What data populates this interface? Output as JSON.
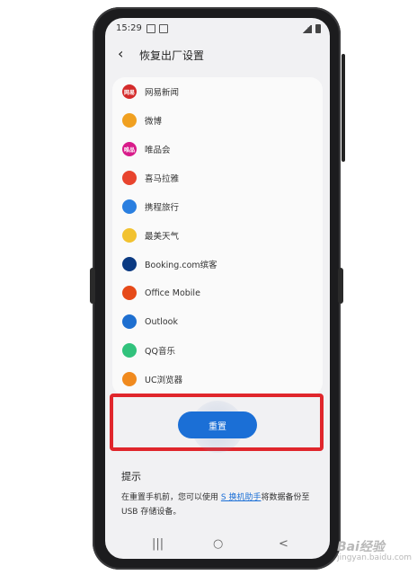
{
  "status": {
    "time": "15:29"
  },
  "header": {
    "title": "恢复出厂设置"
  },
  "apps": [
    {
      "name": "网易新闻",
      "color": "#d42b2b",
      "icon": "netease-news-icon",
      "glyph": "网易"
    },
    {
      "name": "微博",
      "color": "#f0a020",
      "icon": "weibo-icon",
      "glyph": ""
    },
    {
      "name": "唯品会",
      "color": "#d81b8a",
      "icon": "vipshop-icon",
      "glyph": "唯品"
    },
    {
      "name": "喜马拉雅",
      "color": "#e8442e",
      "icon": "ximalaya-icon",
      "glyph": ""
    },
    {
      "name": "携程旅行",
      "color": "#2a7fe0",
      "icon": "ctrip-icon",
      "glyph": ""
    },
    {
      "name": "最美天气",
      "color": "#f2c230",
      "icon": "weather-icon",
      "glyph": ""
    },
    {
      "name": "Booking.com缤客",
      "color": "#0b3a82",
      "icon": "booking-icon",
      "glyph": ""
    },
    {
      "name": "Office Mobile",
      "color": "#e64a19",
      "icon": "office-icon",
      "glyph": ""
    },
    {
      "name": "Outlook",
      "color": "#1e6fd0",
      "icon": "outlook-icon",
      "glyph": ""
    },
    {
      "name": "QQ音乐",
      "color": "#31c27c",
      "icon": "qq-music-icon",
      "glyph": ""
    },
    {
      "name": "UC浏览器",
      "color": "#f08a1e",
      "icon": "uc-browser-icon",
      "glyph": ""
    }
  ],
  "reset": {
    "label": "重置"
  },
  "tips": {
    "title": "提示",
    "text_before": "在重置手机前，您可以使用 ",
    "link": "S 换机助手",
    "text_after": "将数据备份至 USB 存储设备。"
  },
  "nav": {
    "recent": "|||",
    "home": "○",
    "back": "<"
  },
  "watermark": {
    "text": "Bai经验",
    "sub": "jingyan.baidu.com"
  }
}
